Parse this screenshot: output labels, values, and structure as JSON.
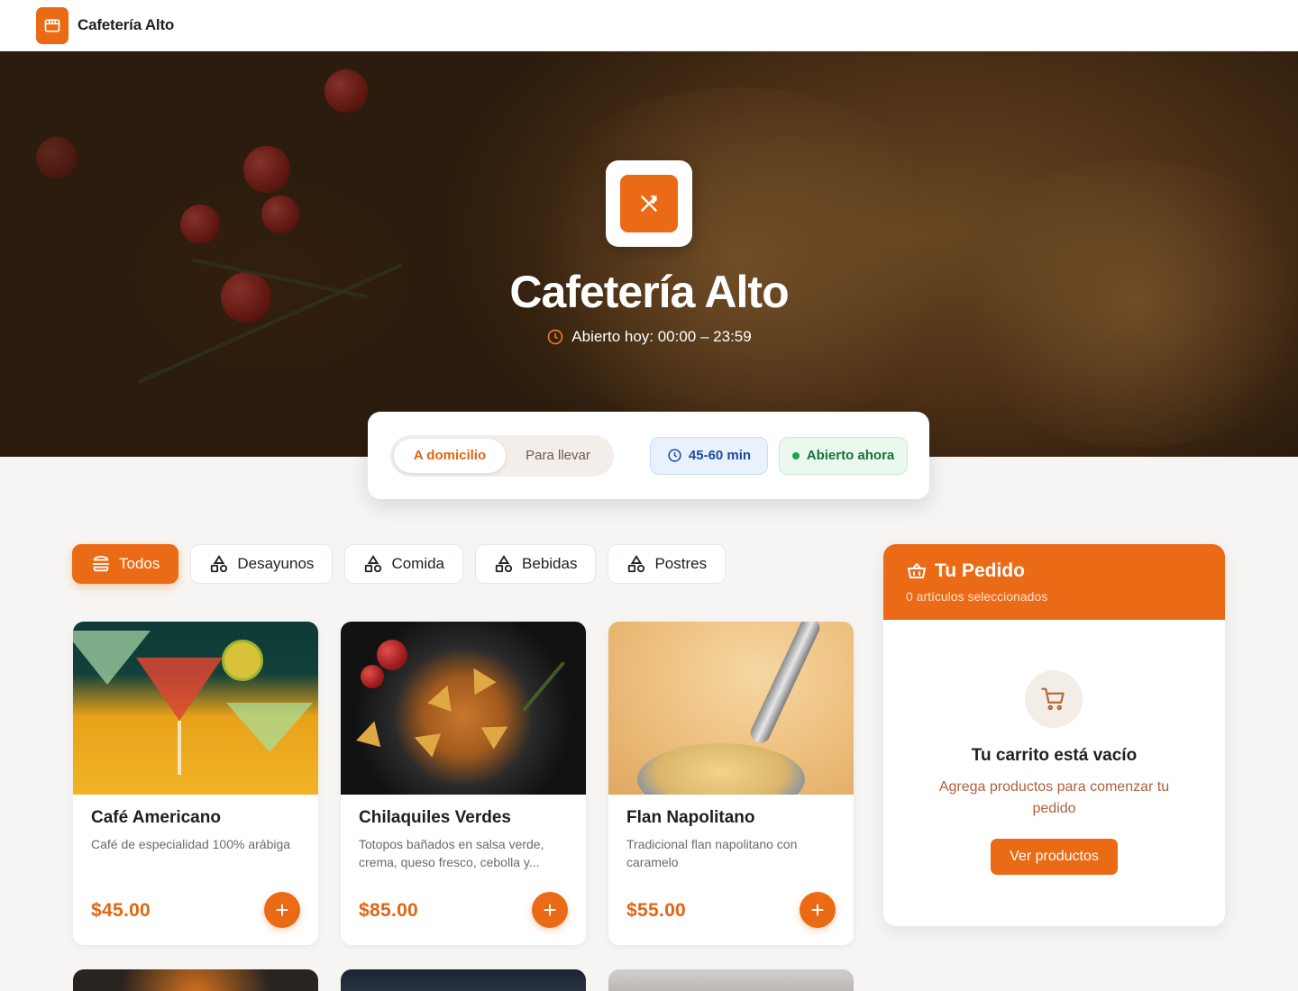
{
  "brand": {
    "name": "Cafetería Alto",
    "icon": "store-icon"
  },
  "hero": {
    "title": "Cafetería Alto",
    "hours": "Abierto hoy: 00:00 – 23:59",
    "logo_icon": "utensils-icon"
  },
  "order": {
    "modes": [
      "A domicilio",
      "Para llevar"
    ],
    "selected_mode": "A domicilio",
    "eta": "45-60 min",
    "status": "Abierto ahora"
  },
  "categories": [
    {
      "label": "Todos",
      "icon": "menu-icon",
      "active": true
    },
    {
      "label": "Desayunos",
      "icon": "shapes-icon",
      "active": false
    },
    {
      "label": "Comida",
      "icon": "shapes-icon",
      "active": false
    },
    {
      "label": "Bebidas",
      "icon": "shapes-icon",
      "active": false
    },
    {
      "label": "Postres",
      "icon": "shapes-icon",
      "active": false
    }
  ],
  "products": [
    {
      "name": "Café Americano",
      "description": "Café de especialidad 100% arábiga",
      "price": "$45.00"
    },
    {
      "name": "Chilaquiles Verdes",
      "description": "Totopos bañados en salsa verde, crema, queso fresco, cebolla y...",
      "price": "$85.00"
    },
    {
      "name": "Flan Napolitano",
      "description": "Tradicional flan napolitano con caramelo",
      "price": "$55.00"
    }
  ],
  "add_button_label": "+",
  "cart": {
    "title": "Tu Pedido",
    "subtitle": "0 artículos seleccionados",
    "empty_title": "Tu carrito está vacío",
    "empty_text": "Agrega productos para comenzar tu pedido",
    "button": "Ver productos"
  },
  "colors": {
    "accent": "#ea6a15",
    "price": "#e26512",
    "status_green": "#15723a",
    "eta_blue": "#1d4a9c"
  }
}
